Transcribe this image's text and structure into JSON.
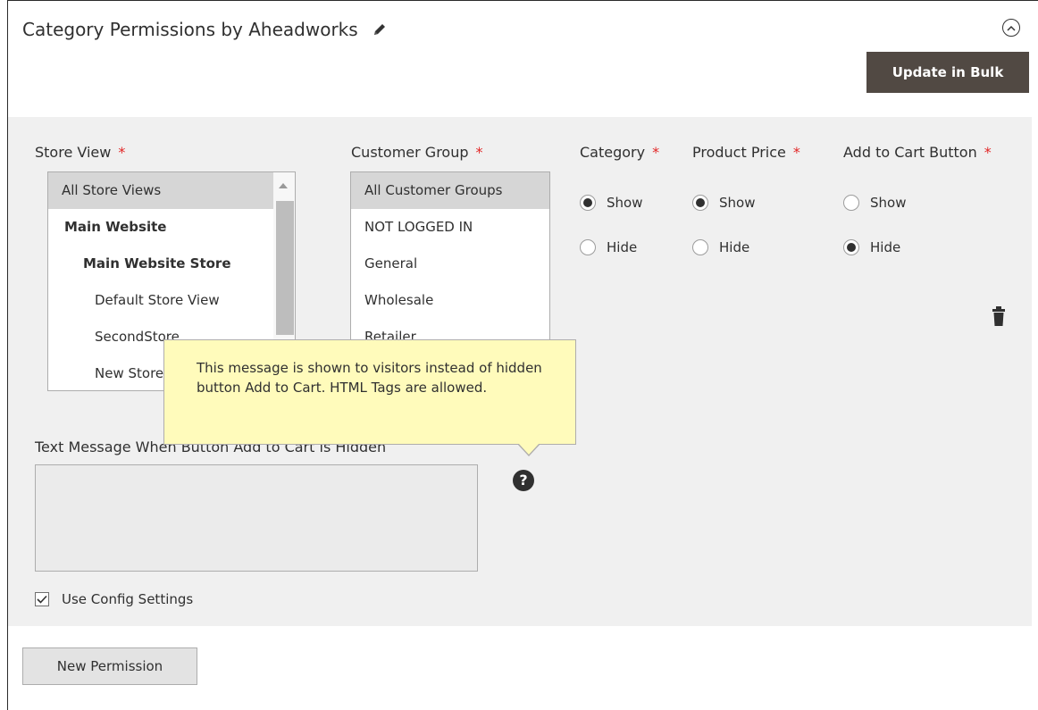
{
  "section": {
    "title": "Category Permissions by Aheadworks",
    "bulk_button_label": "Update in Bulk",
    "new_permission_label": "New Permission"
  },
  "store_view": {
    "label": "Store View",
    "required_mark": "*",
    "options": [
      {
        "label": "All Store Views",
        "selected": true
      },
      {
        "label": "Main Website"
      },
      {
        "label": "Main Website Store"
      },
      {
        "label": "Default Store View"
      },
      {
        "label": "SecondStore"
      },
      {
        "label": "New Store View"
      }
    ]
  },
  "customer_group": {
    "label": "Customer Group",
    "required_mark": "*",
    "options": [
      {
        "label": "All Customer Groups",
        "selected": true
      },
      {
        "label": "NOT LOGGED IN"
      },
      {
        "label": "General"
      },
      {
        "label": "Wholesale"
      },
      {
        "label": "Retailer"
      }
    ]
  },
  "category": {
    "label": "Category",
    "required_mark": "*",
    "show_label": "Show",
    "hide_label": "Hide",
    "value": "Show"
  },
  "product_price": {
    "label": "Product Price",
    "required_mark": "*",
    "show_label": "Show",
    "hide_label": "Hide",
    "value": "Show"
  },
  "add_to_cart": {
    "label": "Add to Cart Button",
    "required_mark": "*",
    "show_label": "Show",
    "hide_label": "Hide",
    "value": "Hide"
  },
  "text_message": {
    "label": "Text Message When Button Add to Cart is Hidden",
    "value": ""
  },
  "tooltip": {
    "text": "This message is shown to visitors instead of hidden button Add to Cart. HTML Tags are allowed."
  },
  "use_config": {
    "label": "Use Config Settings",
    "checked": true
  },
  "icons": {
    "edit": "pencil-icon",
    "collapse": "chevron-up-circle-icon",
    "delete": "trash-icon",
    "help": "question-mark-icon"
  }
}
